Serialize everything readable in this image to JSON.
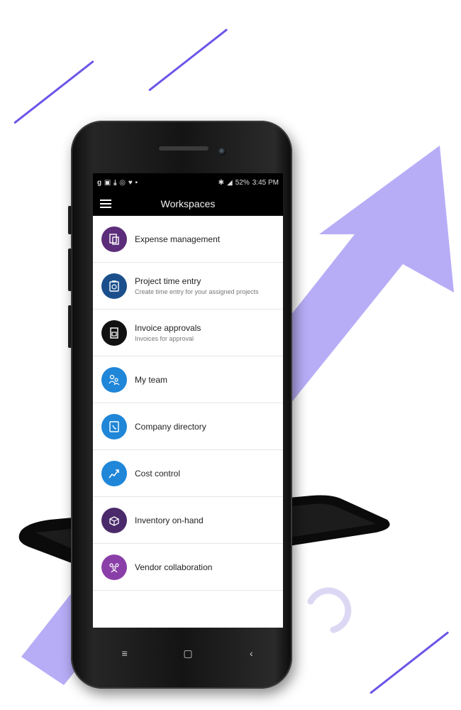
{
  "status_bar": {
    "left_icons": "g ▣ ⤓ ◎ ♥ ▪",
    "battery": "52%",
    "time": "3:45 PM"
  },
  "app_bar": {
    "title": "Workspaces"
  },
  "workspaces": [
    {
      "title": "Expense management",
      "subtitle": "",
      "icon": "receipt-icon",
      "color": "#5c2d7a"
    },
    {
      "title": "Project time entry",
      "subtitle": "Create time entry for your assigned projects",
      "icon": "timesheet-icon",
      "color": "#1a4f8c"
    },
    {
      "title": "Invoice approvals",
      "subtitle": "Invoices for approval",
      "icon": "invoice-icon",
      "color": "#111111"
    },
    {
      "title": "My team",
      "subtitle": "",
      "icon": "team-icon",
      "color": "#1f86d8"
    },
    {
      "title": "Company directory",
      "subtitle": "",
      "icon": "directory-icon",
      "color": "#1f86d8"
    },
    {
      "title": "Cost control",
      "subtitle": "",
      "icon": "chart-icon",
      "color": "#1f86d8"
    },
    {
      "title": "Inventory on-hand",
      "subtitle": "",
      "icon": "boxes-icon",
      "color": "#4a2a6a"
    },
    {
      "title": "Vendor collaboration",
      "subtitle": "",
      "icon": "people-icon",
      "color": "#8a3fa8"
    }
  ],
  "nav_bar": {
    "recent": "≡",
    "home": "▢",
    "back": "‹"
  },
  "colors": {
    "accent_purple": "#b7adf7",
    "line_purple": "#6a55e8"
  }
}
